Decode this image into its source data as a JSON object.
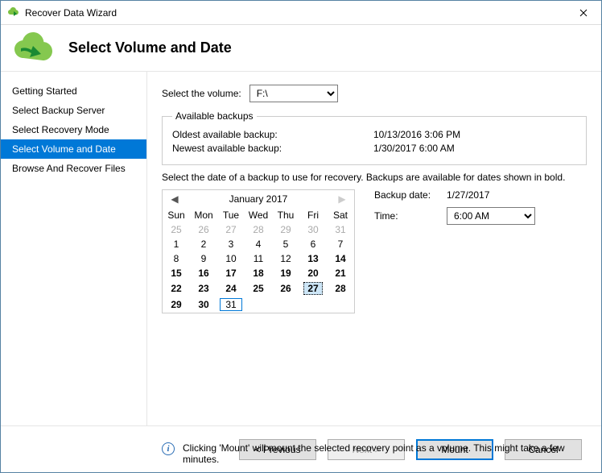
{
  "window": {
    "title": "Recover Data Wizard"
  },
  "header": {
    "title": "Select Volume and Date"
  },
  "sidebar": {
    "items": [
      {
        "label": "Getting Started",
        "active": false
      },
      {
        "label": "Select Backup Server",
        "active": false
      },
      {
        "label": "Select Recovery Mode",
        "active": false
      },
      {
        "label": "Select Volume and Date",
        "active": true
      },
      {
        "label": "Browse And Recover Files",
        "active": false
      }
    ]
  },
  "volume": {
    "label": "Select the volume:",
    "selected": "F:\\"
  },
  "available": {
    "legend": "Available backups",
    "oldest_label": "Oldest available backup:",
    "oldest_value": "10/13/2016 3:06 PM",
    "newest_label": "Newest available backup:",
    "newest_value": "1/30/2017 6:00 AM"
  },
  "instruction": "Select the date of a backup to use for recovery. Backups are available for dates shown in bold.",
  "calendar": {
    "month_title": "January 2017",
    "dow": [
      "Sun",
      "Mon",
      "Tue",
      "Wed",
      "Thu",
      "Fri",
      "Sat"
    ],
    "weeks": [
      [
        {
          "d": 25,
          "out": true
        },
        {
          "d": 26,
          "out": true
        },
        {
          "d": 27,
          "out": true
        },
        {
          "d": 28,
          "out": true
        },
        {
          "d": 29,
          "out": true
        },
        {
          "d": 30,
          "out": true
        },
        {
          "d": 31,
          "out": true
        }
      ],
      [
        {
          "d": 1
        },
        {
          "d": 2
        },
        {
          "d": 3
        },
        {
          "d": 4
        },
        {
          "d": 5
        },
        {
          "d": 6
        },
        {
          "d": 7
        }
      ],
      [
        {
          "d": 8
        },
        {
          "d": 9
        },
        {
          "d": 10
        },
        {
          "d": 11
        },
        {
          "d": 12
        },
        {
          "d": 13,
          "bold": true
        },
        {
          "d": 14,
          "bold": true
        }
      ],
      [
        {
          "d": 15,
          "bold": true
        },
        {
          "d": 16,
          "bold": true
        },
        {
          "d": 17,
          "bold": true
        },
        {
          "d": 18,
          "bold": true
        },
        {
          "d": 19,
          "bold": true
        },
        {
          "d": 20,
          "bold": true
        },
        {
          "d": 21,
          "bold": true
        }
      ],
      [
        {
          "d": 22,
          "bold": true
        },
        {
          "d": 23,
          "bold": true
        },
        {
          "d": 24,
          "bold": true
        },
        {
          "d": 25,
          "bold": true
        },
        {
          "d": 26,
          "bold": true
        },
        {
          "d": 27,
          "bold": true,
          "sel": true
        },
        {
          "d": 28,
          "bold": true
        }
      ],
      [
        {
          "d": 29,
          "bold": true
        },
        {
          "d": 30,
          "bold": true
        },
        {
          "d": 31,
          "today": true
        },
        {
          "d": "",
          "out": true
        },
        {
          "d": "",
          "out": true
        },
        {
          "d": "",
          "out": true
        },
        {
          "d": "",
          "out": true
        }
      ]
    ]
  },
  "backup_date": {
    "label": "Backup date:",
    "value": "1/27/2017"
  },
  "time": {
    "label": "Time:",
    "selected": "6:00 AM"
  },
  "info": {
    "text": "Clicking 'Mount' will mount the selected recovery point as a volume. This might take a few minutes."
  },
  "buttons": {
    "previous": "< Previous",
    "next": "Next >",
    "mount": "Mount",
    "cancel": "Cancel"
  }
}
